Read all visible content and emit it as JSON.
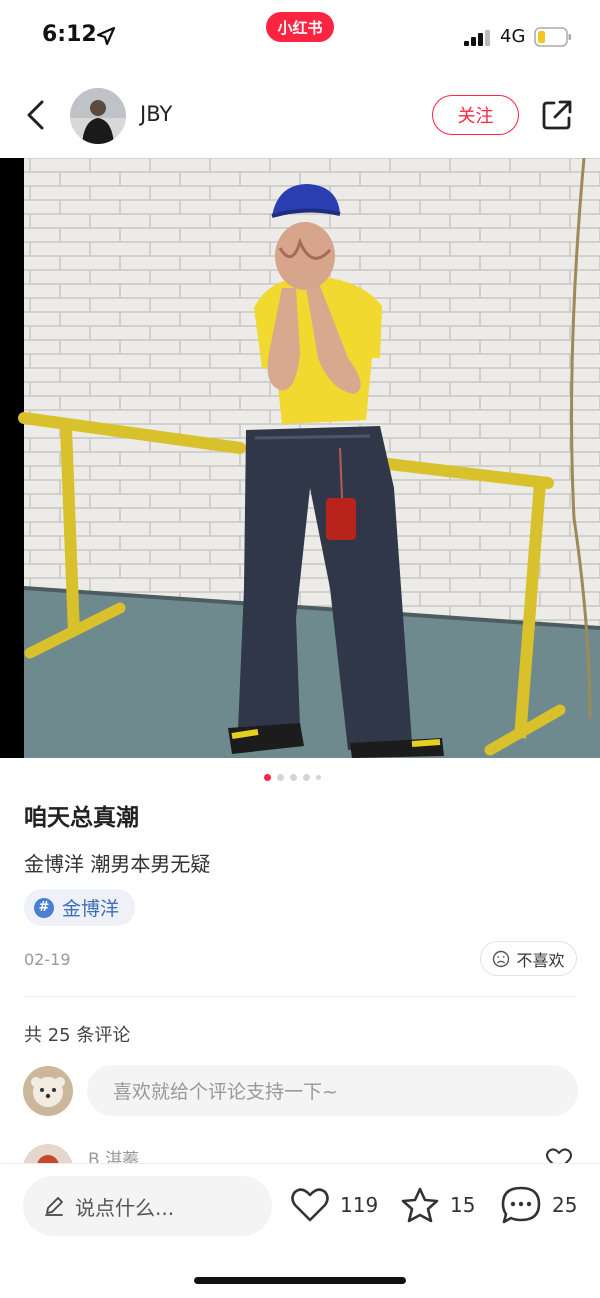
{
  "status_bar": {
    "time": "6:12",
    "app_badge": "小红书",
    "network": "4G"
  },
  "header": {
    "author_name": "JBY",
    "follow_label": "关注"
  },
  "carousel": {
    "total_images": 5,
    "current_index": 1
  },
  "note": {
    "title": "咱天总真潮",
    "body": "金博洋  潮男本男无疑",
    "topic_tag": "金博洋",
    "date": "02-19",
    "dislike_label": "不喜欢"
  },
  "comments": {
    "count_label": "共 25 条评论",
    "input_placeholder": "喜欢就给个评论支持一下~",
    "first_comment_author": "B 淇蓁"
  },
  "bottom_bar": {
    "say_placeholder": "说点什么...",
    "like_count": "119",
    "collect_count": "15",
    "comment_count": "25"
  },
  "colors": {
    "brand": "#ff2442",
    "tag_blue": "#3f6eb8",
    "shirt_yellow": "#f2d930",
    "wall": "#e9e9e6"
  }
}
